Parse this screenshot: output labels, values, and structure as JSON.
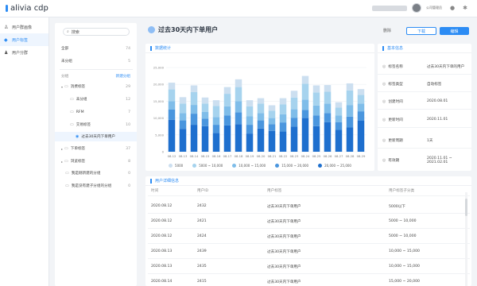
{
  "app": {
    "logo": "alivia cdp"
  },
  "topbar": {
    "user": "公司管理员"
  },
  "sidebar": {
    "items": [
      {
        "label": "用户群画像",
        "icon": "user-portrait-icon"
      },
      {
        "label": "用户标签",
        "icon": "tag-icon"
      },
      {
        "label": "用户分群",
        "icon": "group-icon"
      }
    ]
  },
  "tree": {
    "search_placeholder": "搜索",
    "all": {
      "label": "全部",
      "count": "74"
    },
    "ungrouped": {
      "label": "未分组",
      "count": "5"
    },
    "group_header": "分组",
    "new_group": "新建分组",
    "nodes": [
      {
        "label": "消费标签",
        "count": "29"
      },
      {
        "label": "未分组",
        "count": "12"
      },
      {
        "label": "RFM",
        "count": "7"
      },
      {
        "label": "交易标签",
        "count": "10"
      },
      {
        "label": "过去30天内下单用户",
        "count": ""
      },
      {
        "label": "下单标签",
        "count": "37"
      },
      {
        "label": "浏览标签",
        "count": "8"
      },
      {
        "label": "我是刚新建的分组",
        "count": "0"
      },
      {
        "label": "我是没有建子分组的分组",
        "count": "0"
      }
    ]
  },
  "page": {
    "title": "过去30天内下单用户",
    "delete": "删除",
    "download": "下载",
    "edit": "编辑"
  },
  "stats": {
    "title": "数据统计",
    "legend": [
      "5000",
      "5000 ~ 10,000",
      "10,000 ~ 15,000",
      "15,000 ~ 20,000",
      "20,000 ~ 25,000"
    ],
    "colors": [
      "#ccdff0",
      "#a6d3ee",
      "#7fbde9",
      "#4a96de",
      "#1e6fce"
    ]
  },
  "chart_data": {
    "type": "bar",
    "stacked": true,
    "categories": [
      "08.12",
      "08.13",
      "08.14",
      "08.15",
      "08.16",
      "08.17",
      "08.18",
      "08.19",
      "08.20",
      "08.21",
      "08.22",
      "08.23",
      "08.24",
      "08.25",
      "08.26",
      "08.27",
      "08.28",
      "08.29"
    ],
    "yticks": [
      "0",
      "5,000",
      "10,000",
      "15,000",
      "20,000",
      "25,000"
    ],
    "ylim": [
      0,
      25000
    ],
    "series": [
      {
        "name": "20,000 ~ 25,000",
        "values": [
          9500,
          6800,
          8000,
          7600,
          5600,
          7800,
          8200,
          5400,
          6900,
          6200,
          6000,
          7500,
          10000,
          7600,
          8800,
          6500,
          7200,
          9200
        ]
      },
      {
        "name": "15,000 ~ 20,000",
        "values": [
          3000,
          2500,
          3300,
          2200,
          2400,
          3000,
          3500,
          2600,
          2400,
          2000,
          2700,
          2600,
          2400,
          3200,
          2700,
          2300,
          3200,
          2800
        ]
      },
      {
        "name": "10,000 ~ 15,000",
        "values": [
          2500,
          2200,
          2600,
          2000,
          2300,
          2700,
          3300,
          2500,
          2200,
          1800,
          2400,
          2500,
          3100,
          2900,
          2800,
          2000,
          3400,
          2300
        ]
      },
      {
        "name": "5000 ~ 10,000",
        "values": [
          3500,
          2800,
          3800,
          2500,
          3300,
          3700,
          4200,
          3000,
          2800,
          2200,
          3000,
          3500,
          4700,
          3900,
          3500,
          2300,
          4400,
          2600
        ]
      },
      {
        "name": "5000",
        "values": [
          2000,
          1900,
          2000,
          1800,
          1700,
          2000,
          2300,
          1800,
          1600,
          1600,
          1800,
          2000,
          2300,
          2100,
          2000,
          1600,
          2100,
          1700
        ]
      }
    ]
  },
  "basic": {
    "title": "基本信息",
    "rows": [
      {
        "k": "标签名称",
        "v": "过去30天内下单的用户",
        "icon": "name-icon"
      },
      {
        "k": "标签类型",
        "v": "自动标签",
        "icon": "type-icon"
      },
      {
        "k": "创建时间",
        "v": "2020.08.01",
        "icon": "calendar-icon"
      },
      {
        "k": "更新时间",
        "v": "2020.11.01",
        "icon": "refresh-icon"
      },
      {
        "k": "更新周期",
        "v": "1天",
        "icon": "cycle-icon"
      },
      {
        "k": "有效期",
        "v": "2020.11.01 ~ 2021.02.01",
        "icon": "clock-icon"
      }
    ]
  },
  "detail": {
    "title": "用户详细信息",
    "headers": [
      "时间",
      "用户ID",
      "用户标签",
      "用户标签子分类"
    ],
    "rows": [
      [
        "2020.08.12",
        "2432",
        "过去30天内下单用户",
        "5000以下"
      ],
      [
        "2020.08.12",
        "2421",
        "过去30天内下单用户",
        "5000 ~ 10,000"
      ],
      [
        "2020.08.12",
        "2424",
        "过去30天内下单用户",
        "5000 ~ 10,000"
      ],
      [
        "2020.08.13",
        "2439",
        "过去30天内下单用户",
        "10,000 ~ 15,000"
      ],
      [
        "2020.08.13",
        "2435",
        "过去30天内下单用户",
        "10,000 ~ 15,000"
      ],
      [
        "2020.08.14",
        "2415",
        "过去30天内下单用户",
        "15,000 ~ 20,000"
      ]
    ]
  }
}
